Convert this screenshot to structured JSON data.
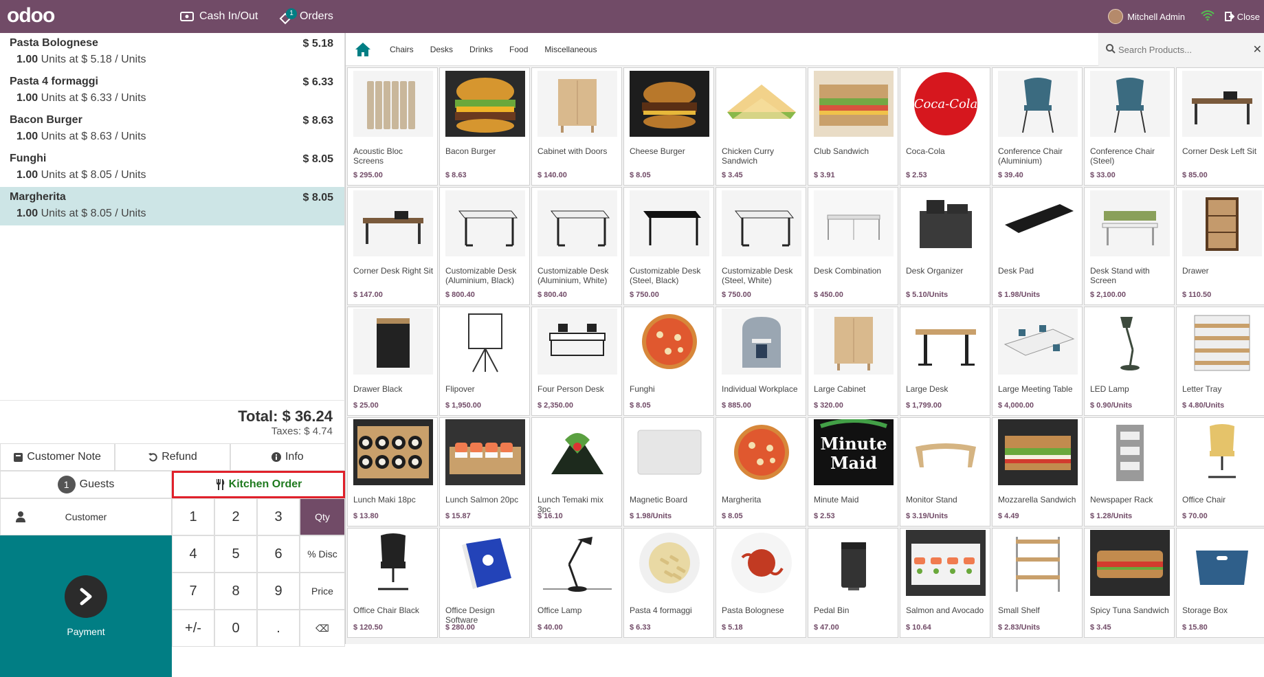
{
  "navbar": {
    "logo": "odoo",
    "cash_label": "Cash In/Out",
    "orders_label": "Orders",
    "orders_badge": "1",
    "user_name": "Mitchell Admin",
    "close_label": "Close"
  },
  "orderlines": [
    {
      "name": "Pasta Bolognese",
      "price": "$ 5.18",
      "qty": "1.00",
      "info": "Units at $ 5.18 / Units"
    },
    {
      "name": "Pasta 4 formaggi",
      "price": "$ 6.33",
      "qty": "1.00",
      "info": "Units at $ 6.33 / Units"
    },
    {
      "name": "Bacon Burger",
      "price": "$ 8.63",
      "qty": "1.00",
      "info": "Units at $ 8.63 / Units"
    },
    {
      "name": "Funghi",
      "price": "$ 8.05",
      "qty": "1.00",
      "info": "Units at $ 8.05 / Units"
    },
    {
      "name": "Margherita",
      "price": "$ 8.05",
      "qty": "1.00",
      "info": "Units at $ 8.05 / Units",
      "selected": true
    }
  ],
  "totals": {
    "total": "Total: $ 36.24",
    "taxes": "Taxes: $ 4.74"
  },
  "controls": {
    "customer_note": "Customer Note",
    "refund": "Refund",
    "info": "Info",
    "guests_count": "1",
    "guests": "Guests",
    "kitchen_order": "Kitchen Order"
  },
  "pad": {
    "customer": "Customer",
    "payment": "Payment",
    "keys": [
      "1",
      "2",
      "3",
      "Qty",
      "4",
      "5",
      "6",
      "% Disc",
      "7",
      "8",
      "9",
      "Price",
      "+/-",
      "0",
      ".",
      "⌫"
    ]
  },
  "categories": [
    "Chairs",
    "Desks",
    "Drinks",
    "Food",
    "Miscellaneous"
  ],
  "search": {
    "placeholder": "Search Products..."
  },
  "products": [
    {
      "name": "Acoustic Bloc Screens",
      "price": "$ 295.00",
      "icon": "screen"
    },
    {
      "name": "Bacon Burger",
      "price": "$ 8.63",
      "icon": "burger"
    },
    {
      "name": "Cabinet with Doors",
      "price": "$ 140.00",
      "icon": "cabinet"
    },
    {
      "name": "Cheese Burger",
      "price": "$ 8.05",
      "icon": "burger-dark"
    },
    {
      "name": "Chicken Curry Sandwich",
      "price": "$ 3.45",
      "icon": "sandwich"
    },
    {
      "name": "Club Sandwich",
      "price": "$ 3.91",
      "icon": "club"
    },
    {
      "name": "Coca-Cola",
      "price": "$ 2.53",
      "icon": "coke"
    },
    {
      "name": "Conference Chair (Aluminium)",
      "price": "$ 39.40",
      "icon": "chair"
    },
    {
      "name": "Conference Chair (Steel)",
      "price": "$ 33.00",
      "icon": "chair"
    },
    {
      "name": "Corner Desk Left Sit",
      "price": "$ 85.00",
      "icon": "corner-desk"
    },
    {
      "name": "Corner Desk Right Sit",
      "price": "$ 147.00",
      "icon": "corner-desk"
    },
    {
      "name": "Customizable Desk (Aluminium, Black)",
      "price": "$ 800.40",
      "icon": "desk"
    },
    {
      "name": "Customizable Desk (Aluminium, White)",
      "price": "$ 800.40",
      "icon": "desk"
    },
    {
      "name": "Customizable Desk (Steel, Black)",
      "price": "$ 750.00",
      "icon": "desk-black"
    },
    {
      "name": "Customizable Desk (Steel, White)",
      "price": "$ 750.00",
      "icon": "desk"
    },
    {
      "name": "Desk Combination",
      "price": "$ 450.00",
      "icon": "desk-combo"
    },
    {
      "name": "Desk Organizer",
      "price": "$ 5.10/Units",
      "icon": "organizer"
    },
    {
      "name": "Desk Pad",
      "price": "$ 1.98/Units",
      "icon": "deskpad"
    },
    {
      "name": "Desk Stand with Screen",
      "price": "$ 2,100.00",
      "icon": "desk-stand"
    },
    {
      "name": "Drawer",
      "price": "$ 110.50",
      "icon": "drawer"
    },
    {
      "name": "Drawer Black",
      "price": "$ 25.00",
      "icon": "drawer-black"
    },
    {
      "name": "Flipover",
      "price": "$ 1,950.00",
      "icon": "flipover"
    },
    {
      "name": "Four Person Desk",
      "price": "$ 2,350.00",
      "icon": "four-desk"
    },
    {
      "name": "Funghi",
      "price": "$ 8.05",
      "icon": "pizza"
    },
    {
      "name": "Individual Workplace",
      "price": "$ 885.00",
      "icon": "workplace"
    },
    {
      "name": "Large Cabinet",
      "price": "$ 320.00",
      "icon": "cabinet"
    },
    {
      "name": "Large Desk",
      "price": "$ 1,799.00",
      "icon": "large-desk"
    },
    {
      "name": "Large Meeting Table",
      "price": "$ 4,000.00",
      "icon": "meeting"
    },
    {
      "name": "LED Lamp",
      "price": "$ 0.90/Units",
      "icon": "lamp"
    },
    {
      "name": "Letter Tray",
      "price": "$ 4.80/Units",
      "icon": "tray"
    },
    {
      "name": "Lunch Maki 18pc",
      "price": "$ 13.80",
      "icon": "maki"
    },
    {
      "name": "Lunch Salmon 20pc",
      "price": "$ 15.87",
      "icon": "salmon"
    },
    {
      "name": "Lunch Temaki mix 3pc",
      "price": "$ 16.10",
      "icon": "temaki"
    },
    {
      "name": "Magnetic Board",
      "price": "$ 1.98/Units",
      "icon": "board"
    },
    {
      "name": "Margherita",
      "price": "$ 8.05",
      "icon": "pizza"
    },
    {
      "name": "Minute Maid",
      "price": "$ 2.53",
      "icon": "minute-maid"
    },
    {
      "name": "Monitor Stand",
      "price": "$ 3.19/Units",
      "icon": "monitor-stand"
    },
    {
      "name": "Mozzarella Sandwich",
      "price": "$ 4.49",
      "icon": "mozza"
    },
    {
      "name": "Newspaper Rack",
      "price": "$ 1.28/Units",
      "icon": "rack"
    },
    {
      "name": "Office Chair",
      "price": "$ 70.00",
      "icon": "office-chair"
    },
    {
      "name": "Office Chair Black",
      "price": "$ 120.50",
      "icon": "office-chair-black"
    },
    {
      "name": "Office Design Software",
      "price": "$ 280.00",
      "icon": "software"
    },
    {
      "name": "Office Lamp",
      "price": "$ 40.00",
      "icon": "office-lamp"
    },
    {
      "name": "Pasta 4 formaggi",
      "price": "$ 6.33",
      "icon": "pasta"
    },
    {
      "name": "Pasta Bolognese",
      "price": "$ 5.18",
      "icon": "pasta-red"
    },
    {
      "name": "Pedal Bin",
      "price": "$ 47.00",
      "icon": "bin"
    },
    {
      "name": "Salmon and Avocado",
      "price": "$ 10.64",
      "icon": "salmon-plate"
    },
    {
      "name": "Small Shelf",
      "price": "$ 2.83/Units",
      "icon": "shelf"
    },
    {
      "name": "Spicy Tuna Sandwich",
      "price": "$ 3.45",
      "icon": "tuna"
    },
    {
      "name": "Storage Box",
      "price": "$ 15.80",
      "icon": "box"
    }
  ],
  "colors": {
    "brand": "#714b67",
    "teal": "#017e84",
    "selected_line": "#cde5e6",
    "kitchen_border": "#e0202a"
  }
}
